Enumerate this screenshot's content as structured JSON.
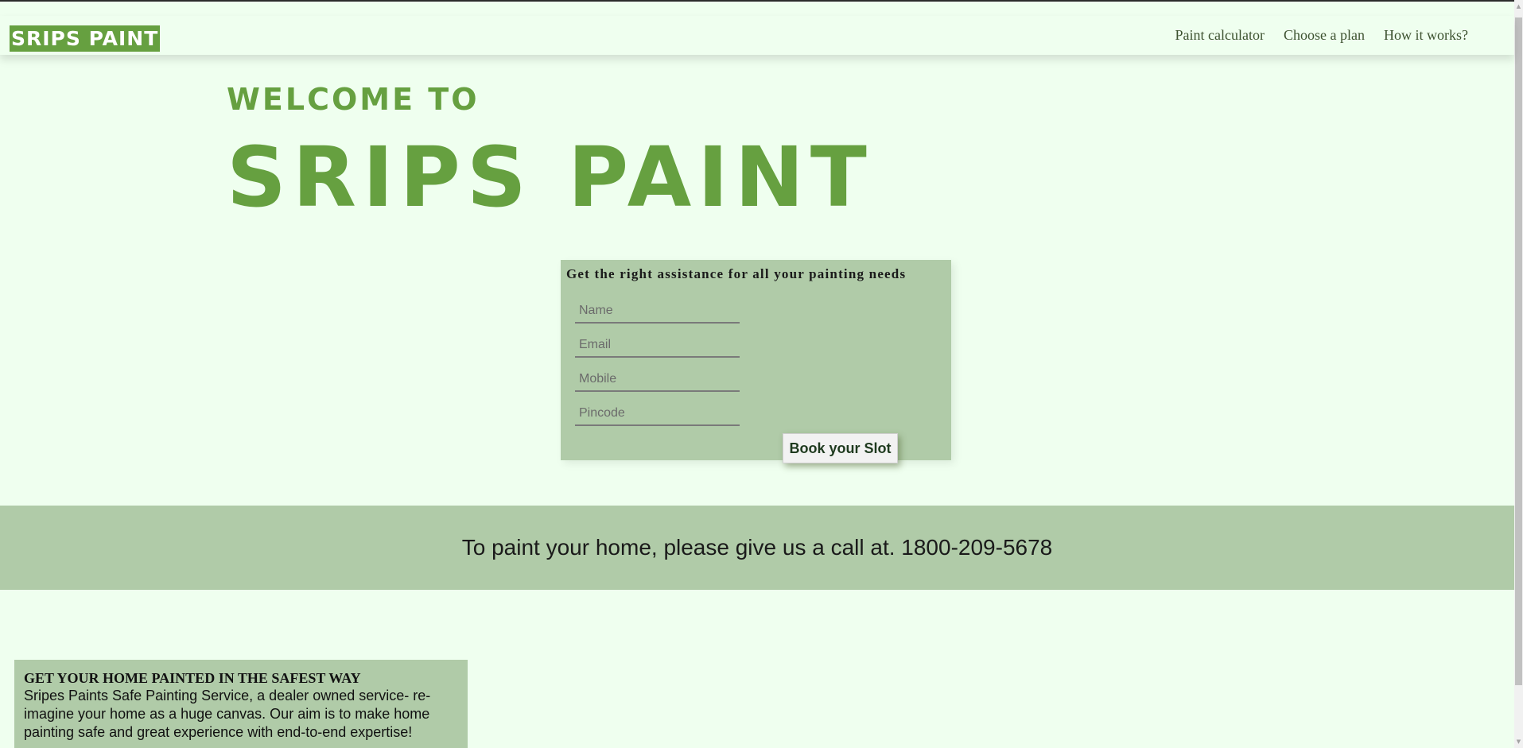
{
  "navbar": {
    "logo": "SRIPS PAINT",
    "links": [
      "Paint calculator",
      "Choose a plan",
      "How it works?"
    ]
  },
  "hero": {
    "welcome": "WELCOME TO",
    "title": "SRIPS PAINT"
  },
  "form": {
    "heading": "Get the right assistance for all your painting needs",
    "fields": [
      {
        "placeholder": "Name",
        "value": ""
      },
      {
        "placeholder": "Email",
        "value": ""
      },
      {
        "placeholder": "Mobile",
        "value": ""
      },
      {
        "placeholder": "Pincode",
        "value": ""
      }
    ],
    "submit_label": "Book your Slot"
  },
  "call_band": {
    "text": "To paint your home, please give us a call at. 1800-209-5678"
  },
  "safe_section": {
    "title": "GET YOUR HOME PAINTED IN THE SAFEST WAY",
    "body": "Sripes Paints Safe Painting Service, a dealer owned service- re-imagine your home as a huge canvas. Our aim is to make home painting safe and great experience with end-to-end expertise!"
  },
  "colors": {
    "background": "#efffef",
    "brand_green": "#66a040",
    "panel_green": "#b0cba8"
  }
}
